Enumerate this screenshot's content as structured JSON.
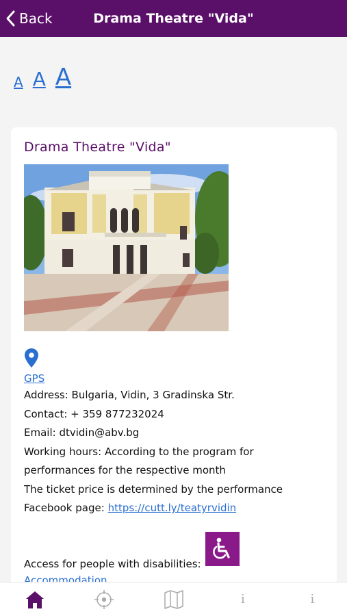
{
  "header": {
    "back_label": "Back",
    "title": "Drama Theatre \"Vida\""
  },
  "font_sizes": {
    "small": "A",
    "medium": "A",
    "large": "A"
  },
  "card": {
    "title": "Drama Theatre \"Vida\"",
    "gps_label": "GPS",
    "address": "Address: Bulgaria, Vidin, 3 Gradinska Str.",
    "contact": "Contact: + 359 877232024",
    "email": "Email: dtvidin@abv.bg",
    "hours_line1": "Working hours: According to the program for",
    "hours_line2": "performances for the respective month",
    "ticket": "The ticket price is determined by the performance",
    "facebook_label": "Facebook page:",
    "facebook_url": "https://cutt.ly/teatyrvidin",
    "access_label": "Access for people with disabilities:",
    "accommodation": "Accommodation"
  },
  "bottom_nav": {
    "tabs": [
      {
        "icon": "home-icon",
        "active": true
      },
      {
        "icon": "target-icon",
        "active": false
      },
      {
        "icon": "map-icon",
        "active": false
      },
      {
        "icon": "info-icon",
        "label": "i",
        "active": false
      },
      {
        "icon": "info-icon",
        "label": "i",
        "active": false
      }
    ]
  },
  "colors": {
    "brand": "#5a0f68",
    "link": "#2a6fd0",
    "accessibility": "#8a1a8a",
    "inactive_icon": "#aaaaaa"
  }
}
